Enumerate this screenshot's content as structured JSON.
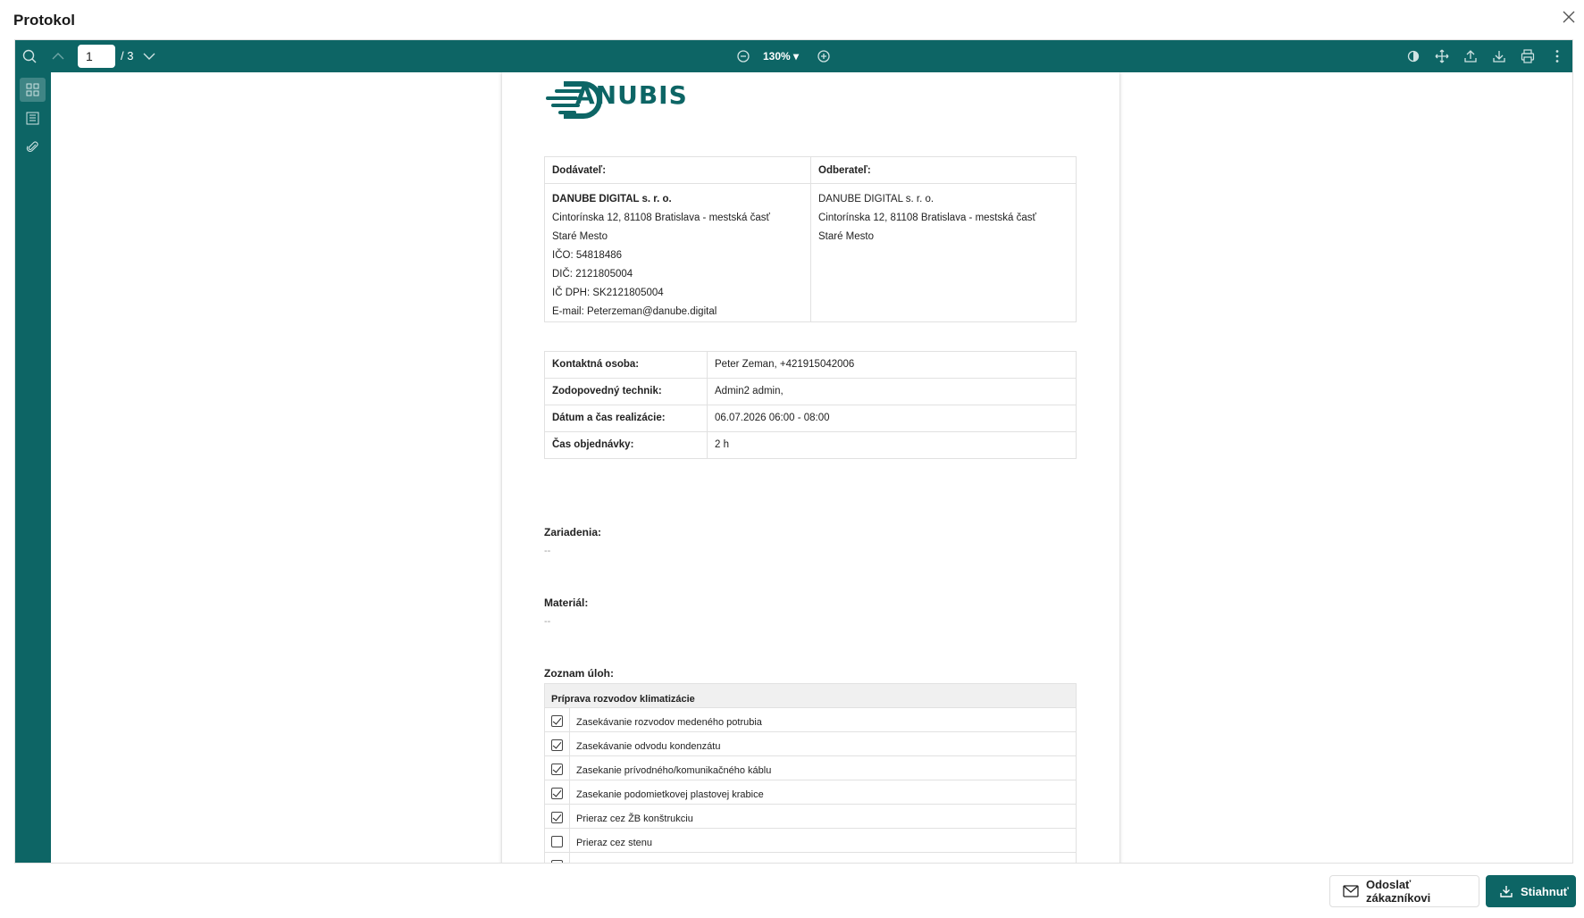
{
  "modal": {
    "title": "Protokol"
  },
  "toolbar": {
    "page_current": "1",
    "page_total": "/ 3",
    "zoom": "130% ▾",
    "icons": [
      "search-icon",
      "chevron-up-icon",
      "chevron-down-icon",
      "zoom-out-icon",
      "zoom-in-icon",
      "rotate-icon",
      "move-icon",
      "upload-icon",
      "download-icon",
      "print-icon",
      "more-icon"
    ]
  },
  "sidebar": {
    "items": [
      {
        "name": "thumbnails",
        "icon": "thumbnails-icon",
        "active": true
      },
      {
        "name": "outline",
        "icon": "outline-icon",
        "active": false
      },
      {
        "name": "attachments",
        "icon": "paperclip-icon",
        "active": false
      }
    ]
  },
  "document": {
    "logo_text": "ANUBIS",
    "supplier": {
      "heading": "Dodávateľ:",
      "name": "DANUBE DIGITAL s. r. o.",
      "address": "Cintorínska 12, 81108 Bratislava - mestská časť",
      "district": "Staré Mesto",
      "ico": "IČO: 54818486",
      "dic": "DIČ: 2121805004",
      "icdph": "IČ DPH: SK2121805004",
      "email": "E-mail: Peterzeman@danube.digital"
    },
    "customer": {
      "heading": "Odberateľ:",
      "name": "DANUBE DIGITAL s. r. o.",
      "address": "Cintorínska 12, 81108 Bratislava - mestská časť",
      "district": "Staré Mesto"
    },
    "info": [
      {
        "label": "Kontaktná osoba:",
        "value": "Peter Zeman, +421915042006"
      },
      {
        "label": "Zodopovedný technik:",
        "value": "Admin2 admin,"
      },
      {
        "label": "Dátum a čas realizácie:",
        "value": "06.07.2026 06:00 - 08:00"
      },
      {
        "label": "Čas objednávky:",
        "value": "2 h"
      }
    ],
    "devices": {
      "title": "Zariadenia:",
      "value": "--"
    },
    "material": {
      "title": "Materiál:",
      "value": "--"
    },
    "tasks": {
      "title": "Zoznam úloh:",
      "group": "Príprava rozvodov klimatizácie",
      "items": [
        {
          "label": "Zasekávanie rozvodov medeného potrubia",
          "checked": true
        },
        {
          "label": "Zasekávanie odvodu kondenzátu",
          "checked": true
        },
        {
          "label": "Zasekanie prívodného/komunikačného káblu",
          "checked": true
        },
        {
          "label": "Zasekanie podomietkovej plastovej krabice",
          "checked": true
        },
        {
          "label": "Prieraz cez ŽB konštrukciu",
          "checked": true
        },
        {
          "label": "Prieraz cez stenu",
          "checked": false
        },
        {
          "label": "",
          "checked": false
        }
      ]
    }
  },
  "footer": {
    "send_label": "Odoslať zákazníkovi",
    "download_label": "Stiahnuť"
  },
  "colors": {
    "accent": "#0d6565",
    "sidebar_active": "#3f8585"
  }
}
